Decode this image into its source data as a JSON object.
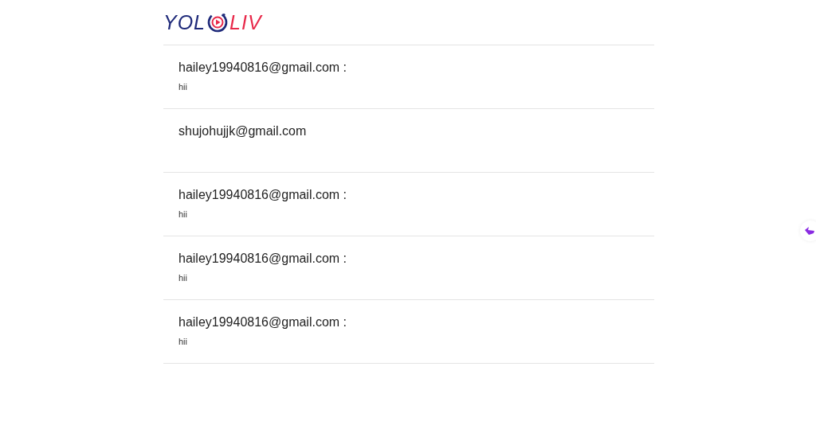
{
  "logo": {
    "left": "YOL",
    "right": "LIV"
  },
  "messages": [
    {
      "sender": "hailey19940816@gmail.com :",
      "text": "hii"
    },
    {
      "sender": "shujohujjk@gmail.com"
    },
    {
      "sender": "hailey19940816@gmail.com :",
      "text": "hii"
    },
    {
      "sender": "hailey19940816@gmail.com :",
      "text": "hii"
    },
    {
      "sender": "hailey19940816@gmail.com :",
      "text": "hii"
    }
  ]
}
